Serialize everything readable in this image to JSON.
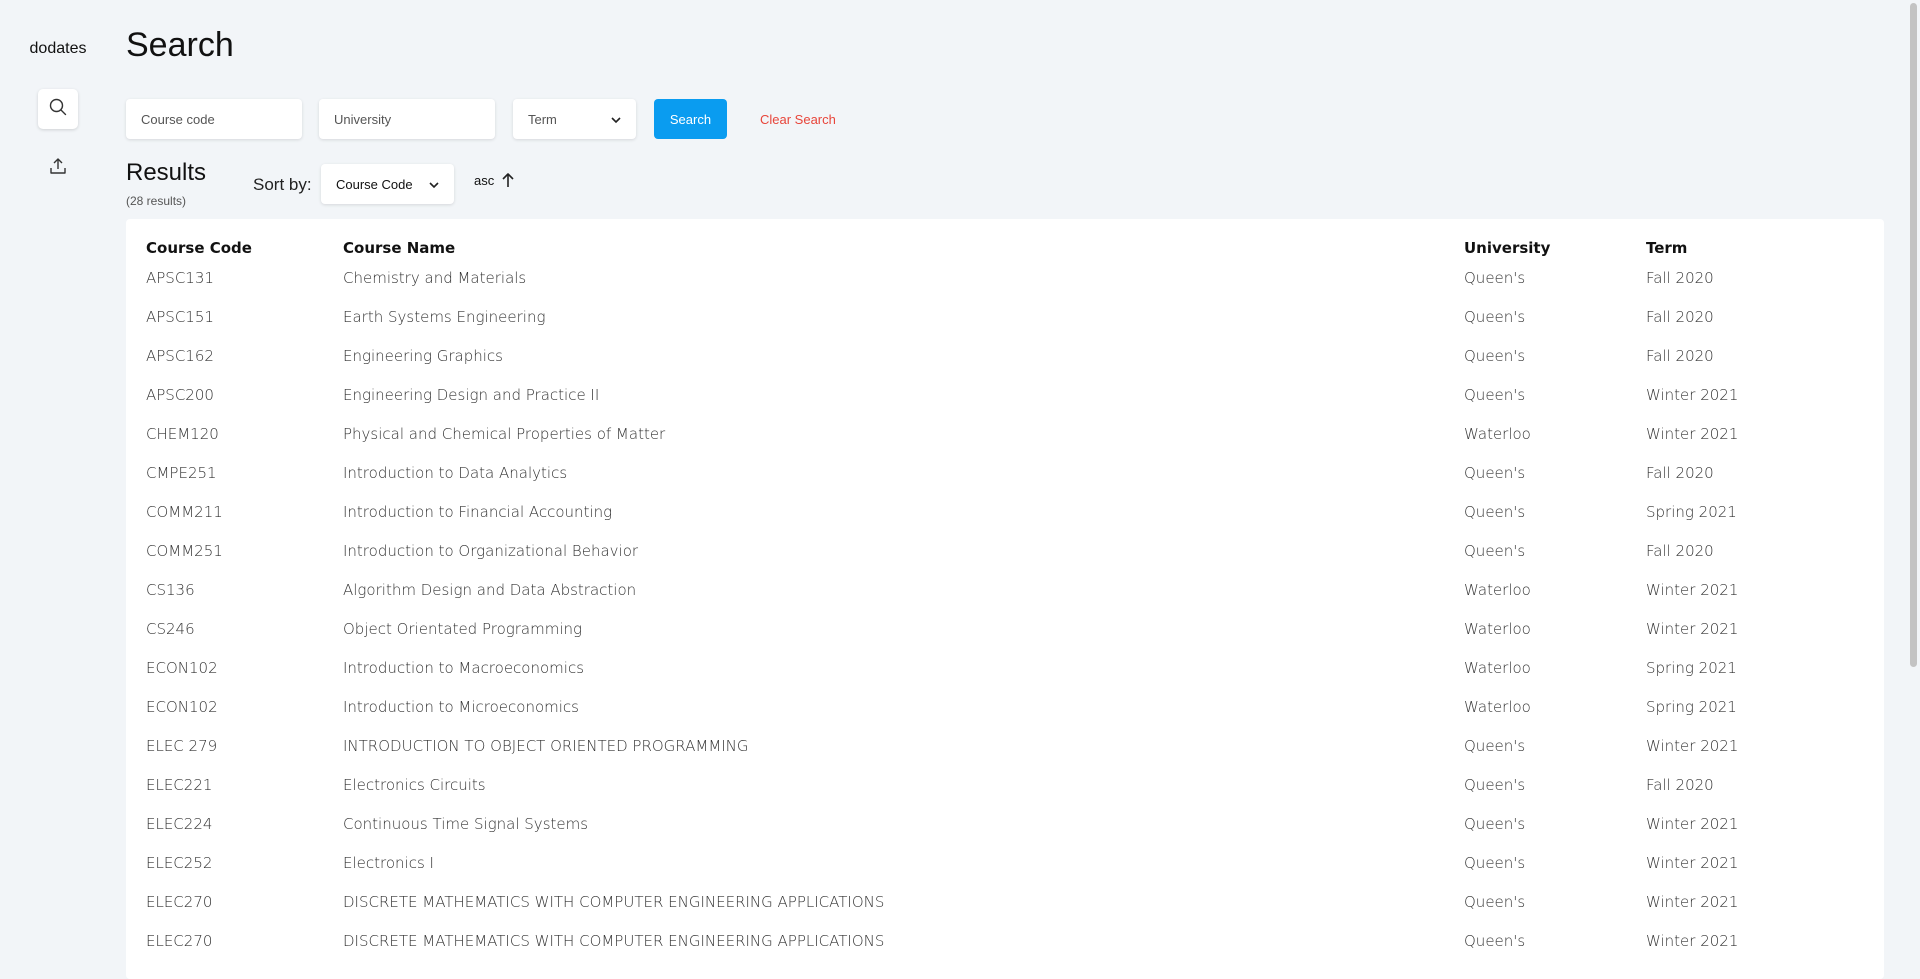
{
  "app": {
    "brand": "dodates"
  },
  "nav": [
    {
      "icon": "search-icon",
      "active": true
    },
    {
      "icon": "upload-icon",
      "active": false
    }
  ],
  "page": {
    "title": "Search"
  },
  "search": {
    "course_code_placeholder": "Course code",
    "university_placeholder": "University",
    "term_selected": "Term",
    "search_label": "Search",
    "clear_label": "Clear Search"
  },
  "results": {
    "title": "Results",
    "count": "(28 results)",
    "sort_label": "Sort by:",
    "sort_selected": "Course Code",
    "sort_direction": "asc"
  },
  "table": {
    "headers": [
      "Course Code",
      "Course Name",
      "University",
      "Term"
    ],
    "rows": [
      [
        "APSC131",
        "Chemistry and Materials",
        "Queen's",
        "Fall 2020"
      ],
      [
        "APSC151",
        "Earth Systems Engineering",
        "Queen's",
        "Fall 2020"
      ],
      [
        "APSC162",
        "Engineering Graphics",
        "Queen's",
        "Fall 2020"
      ],
      [
        "APSC200",
        "Engineering Design and Practice II",
        "Queen's",
        "Winter 2021"
      ],
      [
        "CHEM120",
        "Physical and Chemical Properties of Matter",
        "Waterloo",
        "Winter 2021"
      ],
      [
        "CMPE251",
        "Introduction to Data Analytics",
        "Queen's",
        "Fall 2020"
      ],
      [
        "COMM211",
        "Introduction to Financial Accounting",
        "Queen's",
        "Spring 2021"
      ],
      [
        "COMM251",
        "Introduction to Organizational Behavior",
        "Queen's",
        "Fall 2020"
      ],
      [
        "CS136",
        "Algorithm Design and Data Abstraction",
        "Waterloo",
        "Winter 2021"
      ],
      [
        "CS246",
        "Object Orientated Programming",
        "Waterloo",
        "Winter 2021"
      ],
      [
        "ECON102",
        "Introduction to Macroeconomics",
        "Waterloo",
        "Spring 2021"
      ],
      [
        "ECON102",
        "Introduction to Microeconomics",
        "Waterloo",
        "Spring 2021"
      ],
      [
        "ELEC 279",
        "INTRODUCTION TO OBJECT ORIENTED PROGRAMMING",
        "Queen's",
        "Winter 2021"
      ],
      [
        "ELEC221",
        "Electronics Circuits",
        "Queen's",
        "Fall 2020"
      ],
      [
        "ELEC224",
        "Continuous Time Signal Systems",
        "Queen's",
        "Winter 2021"
      ],
      [
        "ELEC252",
        "Electronics I",
        "Queen's",
        "Winter 2021"
      ],
      [
        "ELEC270",
        "DISCRETE MATHEMATICS WITH COMPUTER ENGINEERING APPLICATIONS",
        "Queen's",
        "Winter 2021"
      ],
      [
        "ELEC270",
        "DISCRETE MATHEMATICS WITH COMPUTER ENGINEERING APPLICATIONS",
        "Queen's",
        "Winter 2021"
      ]
    ]
  },
  "colors": {
    "background": "#f2f5f8",
    "accent": "#0a9cf0",
    "danger": "#e8453a"
  }
}
